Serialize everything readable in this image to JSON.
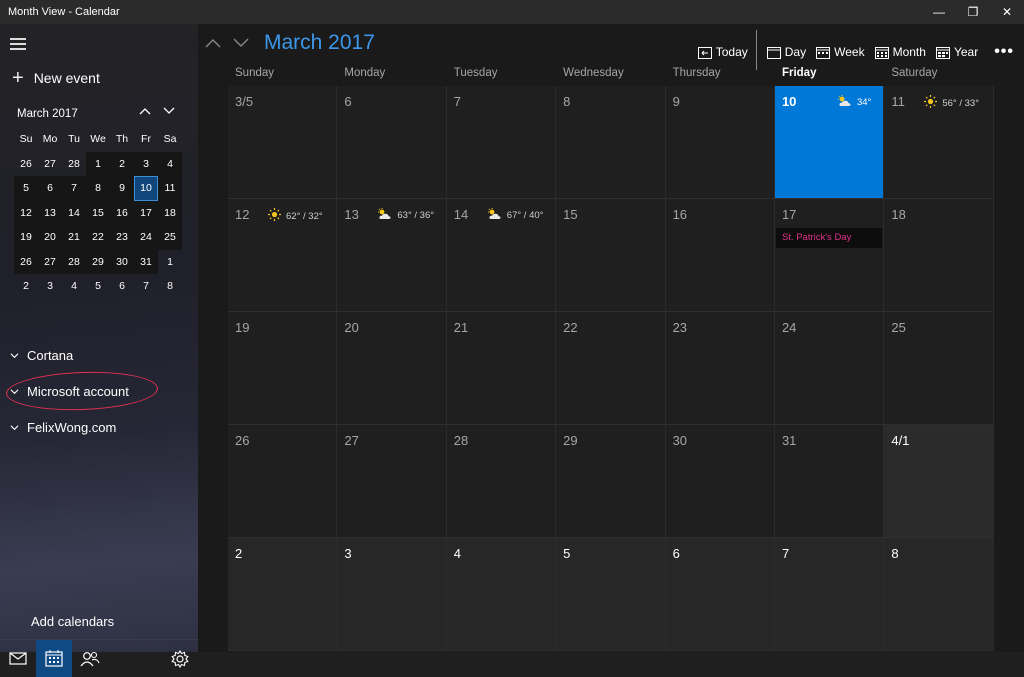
{
  "window": {
    "title": "Month View - Calendar",
    "controls": {
      "minimize": "—",
      "restore": "❐",
      "close": "✕"
    }
  },
  "sidebar": {
    "new_event_label": "New event",
    "mini_calendar": {
      "title": "March 2017",
      "day_headers": [
        "Su",
        "Mo",
        "Tu",
        "We",
        "Th",
        "Fr",
        "Sa"
      ],
      "weeks": [
        [
          "26",
          "27",
          "28",
          "1",
          "2",
          "3",
          "4"
        ],
        [
          "5",
          "6",
          "7",
          "8",
          "9",
          "10",
          "11"
        ],
        [
          "12",
          "13",
          "14",
          "15",
          "16",
          "17",
          "18"
        ],
        [
          "19",
          "20",
          "21",
          "22",
          "23",
          "24",
          "25"
        ],
        [
          "26",
          "27",
          "28",
          "29",
          "30",
          "31",
          "1"
        ],
        [
          "2",
          "3",
          "4",
          "5",
          "6",
          "7",
          "8"
        ]
      ],
      "selected_day": "10"
    },
    "accounts": [
      "Cortana",
      "Microsoft account",
      "FelixWong.com"
    ],
    "add_calendars_label": "Add calendars",
    "bottom_icons": [
      "mail-icon",
      "calendar-icon",
      "people-icon",
      "settings-icon"
    ]
  },
  "main": {
    "month_title": "March 2017",
    "views": {
      "today": "Today",
      "day": "Day",
      "week": "Week",
      "month": "Month",
      "year": "Year"
    },
    "more_label": "•••",
    "day_headers": [
      "Sunday",
      "Monday",
      "Tuesday",
      "Wednesday",
      "Thursday",
      "Friday",
      "Saturday"
    ],
    "weeks": [
      [
        {
          "label": "3/5"
        },
        {
          "label": "6"
        },
        {
          "label": "7"
        },
        {
          "label": "8"
        },
        {
          "label": "9"
        },
        {
          "label": "10",
          "today": true,
          "weather": "34°",
          "weather_icon": "partly-cloudy-icon"
        },
        {
          "label": "11",
          "weather": "56° / 33°",
          "weather_icon": "sun-icon"
        }
      ],
      [
        {
          "label": "12",
          "weather": "62° / 32°",
          "weather_icon": "sun-icon"
        },
        {
          "label": "13",
          "weather": "63° / 36°",
          "weather_icon": "partly-cloudy-icon"
        },
        {
          "label": "14",
          "weather": "67° / 40°",
          "weather_icon": "partly-cloudy-icon"
        },
        {
          "label": "15"
        },
        {
          "label": "16"
        },
        {
          "label": "17",
          "event": "St. Patrick's Day"
        },
        {
          "label": "18"
        }
      ],
      [
        {
          "label": "19"
        },
        {
          "label": "20"
        },
        {
          "label": "21"
        },
        {
          "label": "22"
        },
        {
          "label": "23"
        },
        {
          "label": "24"
        },
        {
          "label": "25"
        }
      ],
      [
        {
          "label": "26"
        },
        {
          "label": "27"
        },
        {
          "label": "28"
        },
        {
          "label": "29"
        },
        {
          "label": "30"
        },
        {
          "label": "31"
        },
        {
          "label": "4/1",
          "first_next": true
        }
      ],
      [
        {
          "label": "2",
          "next": true
        },
        {
          "label": "3",
          "next": true
        },
        {
          "label": "4",
          "next": true
        },
        {
          "label": "5",
          "next": true
        },
        {
          "label": "6",
          "next": true
        },
        {
          "label": "7",
          "next": true
        },
        {
          "label": "8",
          "next": true
        }
      ]
    ]
  },
  "colors": {
    "accent": "#0078d7",
    "title_blue": "#3d97e8",
    "event_pink": "#e0338a",
    "annotation_red": "#e0314f"
  }
}
